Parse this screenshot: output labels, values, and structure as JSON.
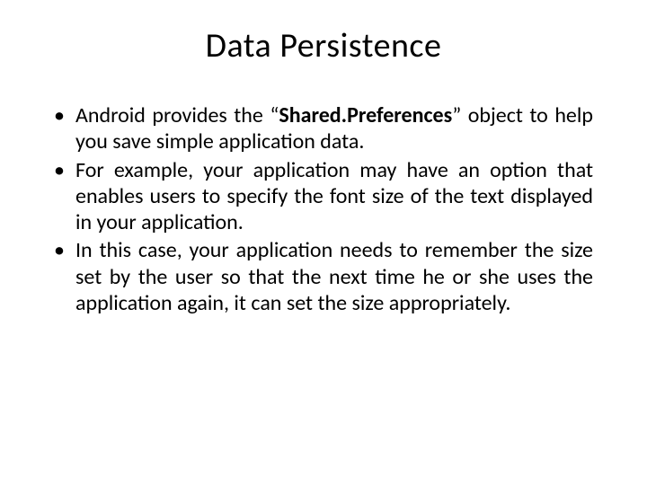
{
  "title": "Data Persistence",
  "bullets": [
    {
      "pre": "Android provides the “",
      "bold": "Shared.Preferences",
      "post": "” object to help you save simple application data."
    },
    {
      "pre": "For example, your application may have an option that enables users to specify the font size of the text displayed in your application.",
      "bold": "",
      "post": ""
    },
    {
      "pre": "In this case, your application needs to remember the size set by the user so that the next time he or she uses the application again, it can set the size appropriately.",
      "bold": "",
      "post": ""
    }
  ],
  "bullet_char": "•"
}
